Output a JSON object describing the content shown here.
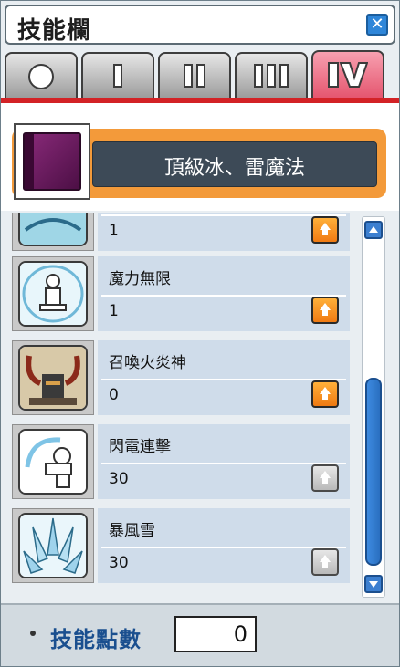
{
  "window": {
    "title": "技能欄"
  },
  "tabs": [
    {
      "name": "beginner",
      "active": false
    },
    {
      "name": "job-1",
      "active": false
    },
    {
      "name": "job-2",
      "active": false
    },
    {
      "name": "job-3",
      "active": false
    },
    {
      "name": "job-4",
      "active": true
    }
  ],
  "category": {
    "title": "頂級冰、雷魔法"
  },
  "skills": [
    {
      "name": "",
      "level": "1",
      "can_level": true,
      "icon": "partial-skill-icon"
    },
    {
      "name": "魔力無限",
      "level": "1",
      "can_level": true,
      "icon": "infinity-skill-icon"
    },
    {
      "name": "召喚火炎神",
      "level": "0",
      "can_level": true,
      "icon": "ifrit-skill-icon"
    },
    {
      "name": "閃電連擊",
      "level": "30",
      "can_level": false,
      "icon": "chain-lightning-skill-icon"
    },
    {
      "name": "暴風雪",
      "level": "30",
      "can_level": false,
      "icon": "blizzard-skill-icon"
    }
  ],
  "footer": {
    "label": "技能點數",
    "points": "0"
  },
  "colors": {
    "accent_tab": "#e5566f",
    "divider": "#d32226",
    "category_bar": "#f39a3a",
    "scroll": "#2a6fc0"
  }
}
